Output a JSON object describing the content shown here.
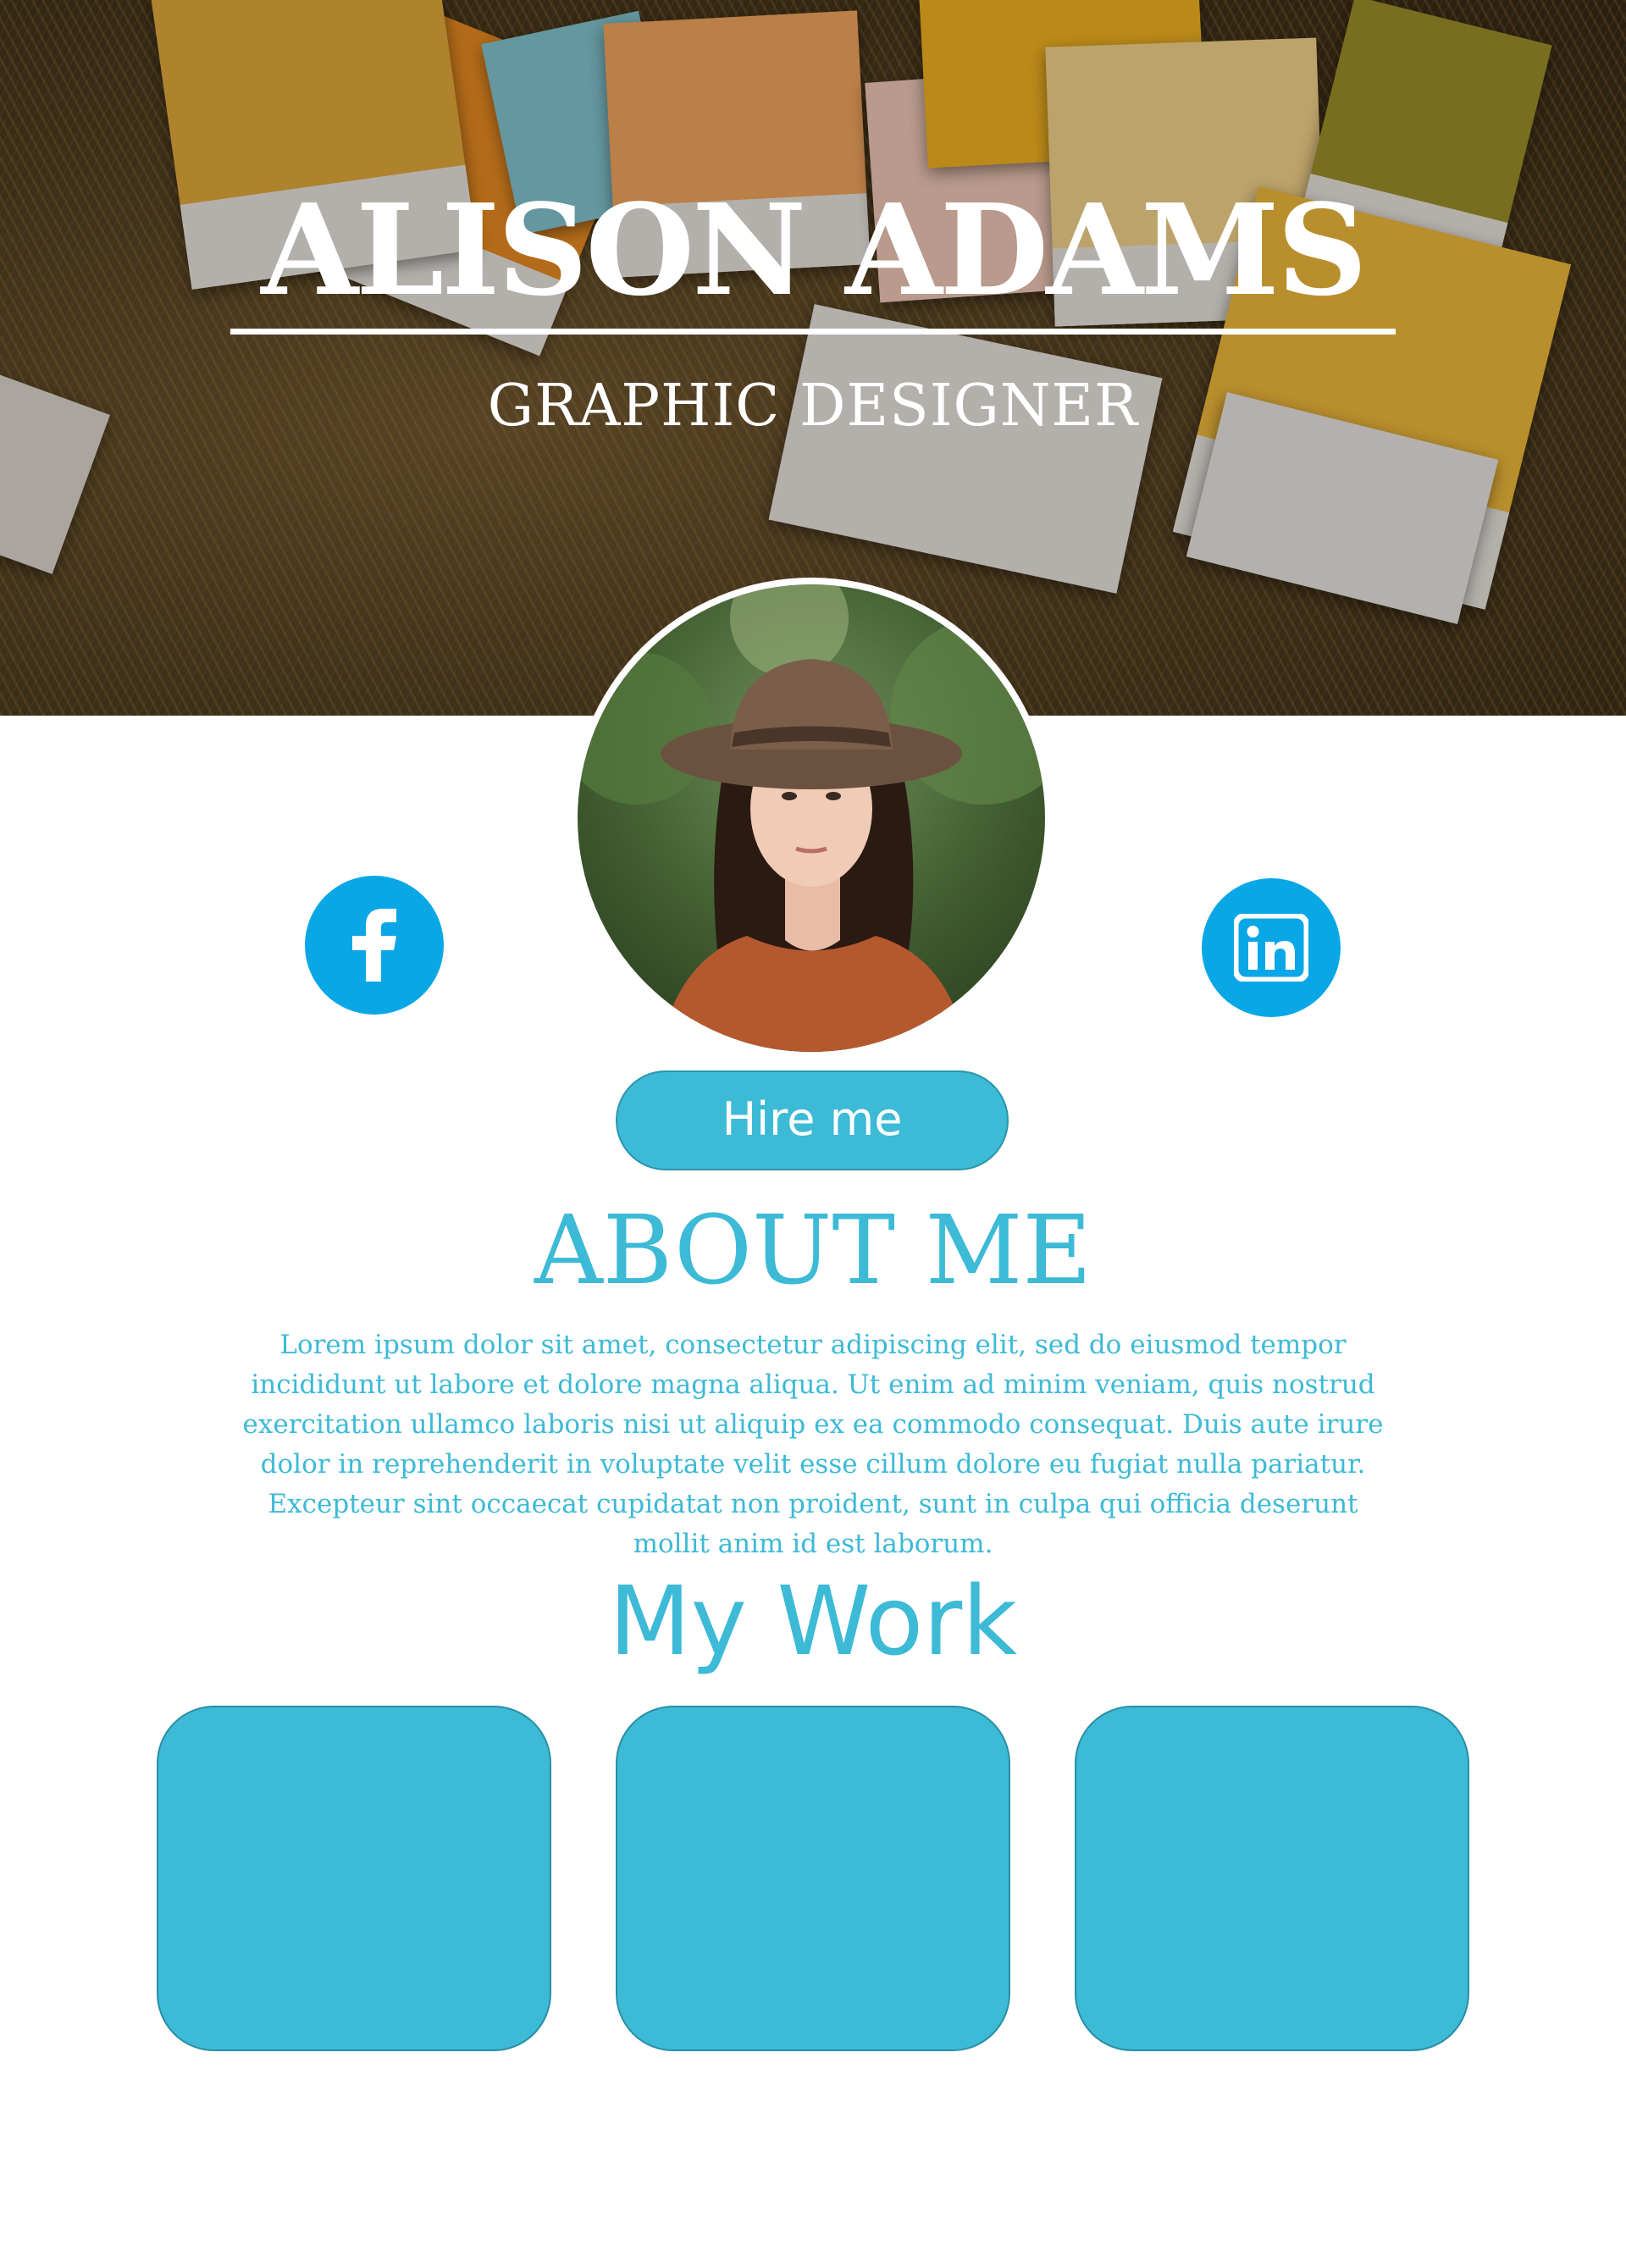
{
  "hero": {
    "name": "ALISON ADAMS",
    "role": "GRAPHIC DESIGNER"
  },
  "social": {
    "facebook_icon": "facebook-icon",
    "linkedin_icon": "linkedin-icon"
  },
  "hire": {
    "label": "Hire me"
  },
  "about": {
    "heading": "ABOUT ME",
    "text": "Lorem ipsum dolor sit amet, consectetur adipiscing elit, sed do eiusmod tempor incididunt ut labore et dolore magna aliqua. Ut enim ad minim veniam, quis nostrud exercitation ullamco laboris nisi ut aliquip ex ea commodo consequat. Duis aute irure dolor in reprehenderit in voluptate velit esse cillum dolore eu fugiat nulla pariatur. Excepteur sint occaecat cupidatat non proident, sunt in culpa qui officia deserunt mollit anim id est laborum."
  },
  "work": {
    "heading": "My Work"
  },
  "colors": {
    "accent": "#3cbad6",
    "social": "#0aa7e6",
    "text_on_accent": "#ffffff"
  }
}
